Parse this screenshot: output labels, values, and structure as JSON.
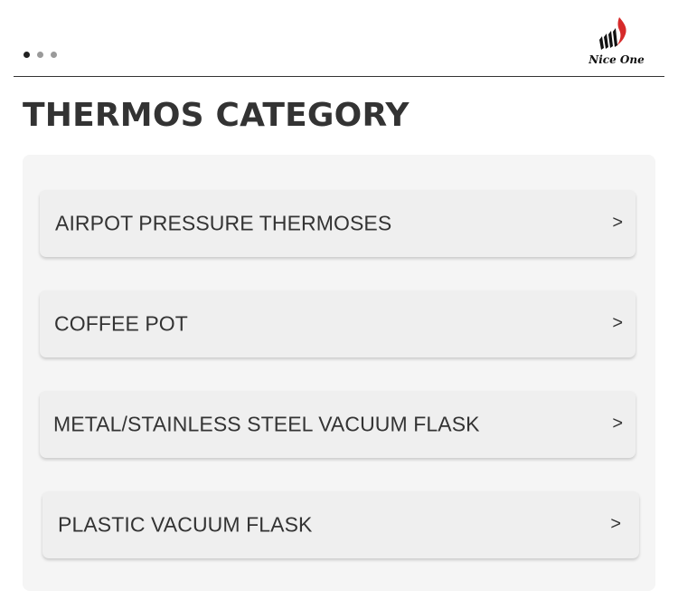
{
  "header": {
    "carousel_dots": 3,
    "active_dot": 0,
    "logo": {
      "icon": "flame-grill-icon",
      "text": "Nice One",
      "accent_color": "#d62a2a"
    }
  },
  "page_title": "THERMOS CATEGORY",
  "categories": [
    {
      "label": "AIRPOT PRESSURE THERMOSES",
      "arrow": ">"
    },
    {
      "label": "COFFEE POT",
      "arrow": ">"
    },
    {
      "label": "METAL/STAINLESS STEEL VACUUM FLASK",
      "arrow": ">"
    },
    {
      "label": "PLASTIC VACUUM FLASK",
      "arrow": ">"
    }
  ]
}
